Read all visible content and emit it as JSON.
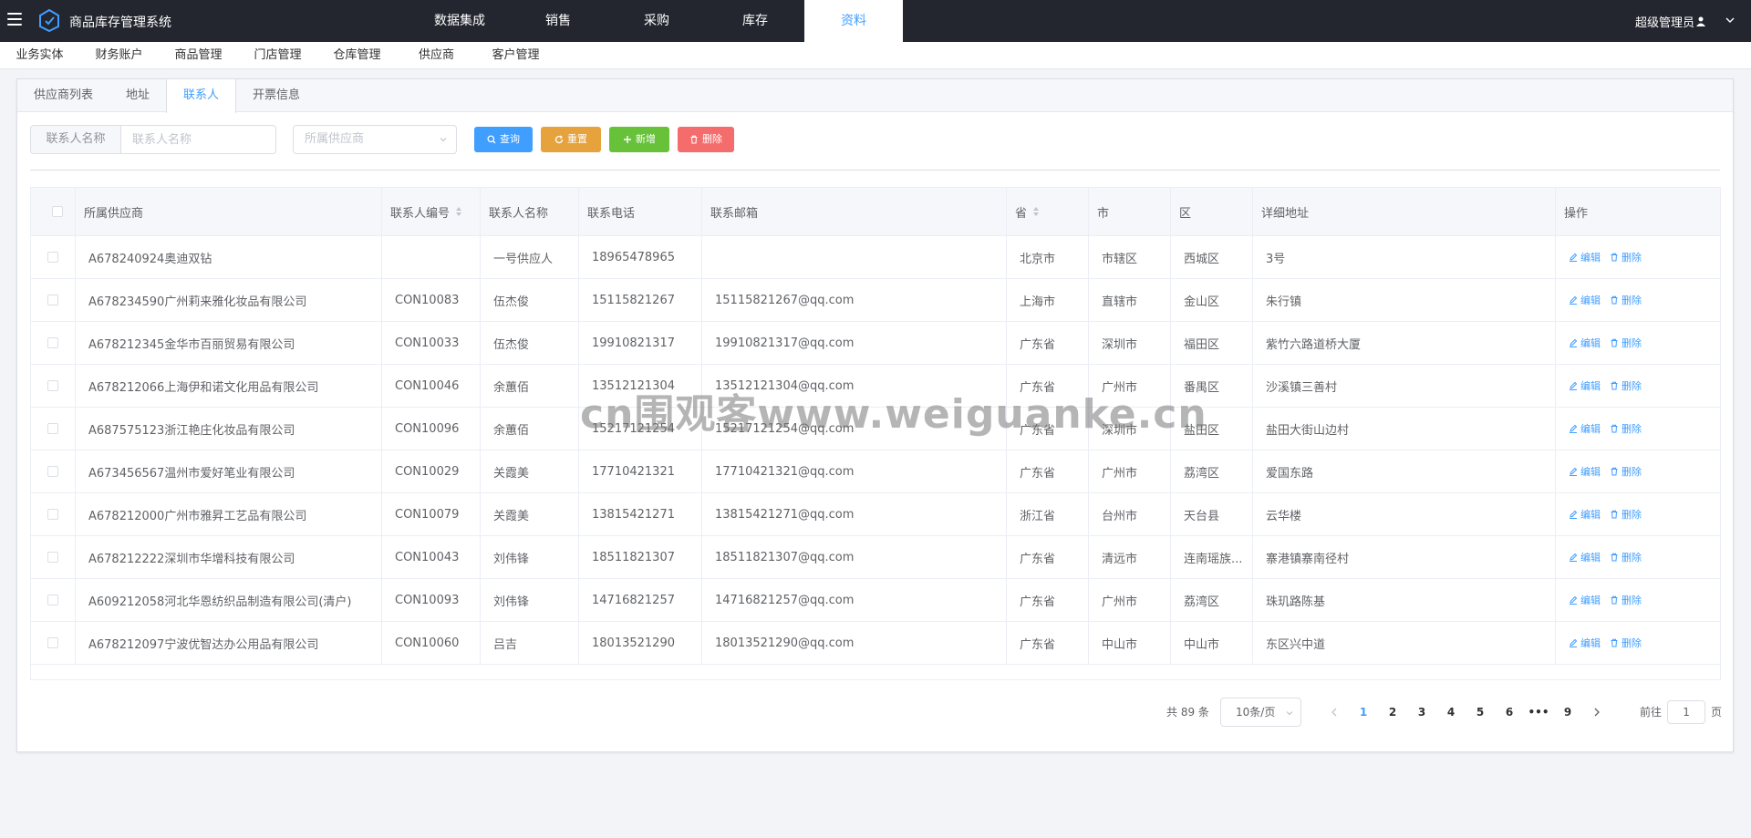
{
  "app": {
    "title": "商品库存管理系统",
    "user": "超级管理员"
  },
  "topnav": [
    {
      "label": "数据集成",
      "active": false
    },
    {
      "label": "销售",
      "active": false
    },
    {
      "label": "采购",
      "active": false
    },
    {
      "label": "库存",
      "active": false
    },
    {
      "label": "资料",
      "active": true
    }
  ],
  "subnav": [
    "业务实体",
    "财务账户",
    "商品管理",
    "门店管理",
    "仓库管理",
    "供应商",
    "客户管理"
  ],
  "tabs": [
    {
      "label": "供应商列表",
      "active": false
    },
    {
      "label": "地址",
      "active": false
    },
    {
      "label": "联系人",
      "active": true
    },
    {
      "label": "开票信息",
      "active": false
    }
  ],
  "filters": {
    "name_label": "联系人名称",
    "name_placeholder": "联系人名称",
    "supplier_placeholder": "所属供应商"
  },
  "buttons": {
    "query": "查询",
    "reset": "重置",
    "add": "新增",
    "delete": "删除"
  },
  "table": {
    "columns": [
      "所属供应商",
      "联系人编号",
      "联系人名称",
      "联系电话",
      "联系邮箱",
      "省",
      "市",
      "区",
      "详细地址",
      "操作"
    ],
    "edit_label": "编辑",
    "delete_label": "删除",
    "rows": [
      {
        "supplier": "A678240924奥迪双钻",
        "code": "",
        "name": "一号供应人",
        "phone": "18965478965",
        "email": "",
        "province": "北京市",
        "city": "市辖区",
        "district": "西城区",
        "address": "3号"
      },
      {
        "supplier": "A678234590广州莉来雅化妆品有限公司",
        "code": "CON10083",
        "name": "伍杰俊",
        "phone": "15115821267",
        "email": "15115821267@qq.com",
        "province": "上海市",
        "city": "直辖市",
        "district": "金山区",
        "address": "朱行镇"
      },
      {
        "supplier": "A678212345金华市百丽贸易有限公司",
        "code": "CON10033",
        "name": "伍杰俊",
        "phone": "19910821317",
        "email": "19910821317@qq.com",
        "province": "广东省",
        "city": "深圳市",
        "district": "福田区",
        "address": "紫竹六路道桥大厦"
      },
      {
        "supplier": "A678212066上海伊和诺文化用品有限公司",
        "code": "CON10046",
        "name": "余蕙佰",
        "phone": "13512121304",
        "email": "13512121304@qq.com",
        "province": "广东省",
        "city": "广州市",
        "district": "番禺区",
        "address": "沙溪镇三善村"
      },
      {
        "supplier": "A687575123浙江艳庄化妆品有限公司",
        "code": "CON10096",
        "name": "余蕙佰",
        "phone": "15217121254",
        "email": "15217121254@qq.com",
        "province": "广东省",
        "city": "深圳市",
        "district": "盐田区",
        "address": "盐田大街山边村"
      },
      {
        "supplier": "A673456567温州市爱好笔业有限公司",
        "code": "CON10029",
        "name": "关霞美",
        "phone": "17710421321",
        "email": "17710421321@qq.com",
        "province": "广东省",
        "city": "广州市",
        "district": "荔湾区",
        "address": "爱国东路"
      },
      {
        "supplier": "A678212000广州市雅昇工艺品有限公司",
        "code": "CON10079",
        "name": "关霞美",
        "phone": "13815421271",
        "email": "13815421271@qq.com",
        "province": "浙江省",
        "city": "台州市",
        "district": "天台县",
        "address": "云华楼"
      },
      {
        "supplier": "A678212222深圳市华增科技有限公司",
        "code": "CON10043",
        "name": "刘伟锋",
        "phone": "18511821307",
        "email": "18511821307@qq.com",
        "province": "广东省",
        "city": "清远市",
        "district": "连南瑶族...",
        "address": "寨港镇寨南径村"
      },
      {
        "supplier": "A609212058河北华恩纺织品制造有限公司(清户)",
        "code": "CON10093",
        "name": "刘伟锋",
        "phone": "14716821257",
        "email": "14716821257@qq.com",
        "province": "广东省",
        "city": "广州市",
        "district": "荔湾区",
        "address": "珠玑路陈基"
      },
      {
        "supplier": "A678212097宁波优智达办公用品有限公司",
        "code": "CON10060",
        "name": "吕吉",
        "phone": "18013521290",
        "email": "18013521290@qq.com",
        "province": "广东省",
        "city": "中山市",
        "district": "中山市",
        "address": "东区兴中道"
      }
    ]
  },
  "pagination": {
    "total": "共 89 条",
    "page_size": "10条/页",
    "pages": [
      "1",
      "2",
      "3",
      "4",
      "5",
      "6",
      "•••",
      "9"
    ],
    "current": "1",
    "goto_label": "前往",
    "goto_value": "1",
    "goto_suffix": "页"
  },
  "watermark": "cn围观客www.weiguanke.cn",
  "colors": {
    "primary": "#409eff",
    "warning": "#e6a23c",
    "success": "#67c23a",
    "danger": "#f56c6c",
    "topbar": "#23262e"
  }
}
